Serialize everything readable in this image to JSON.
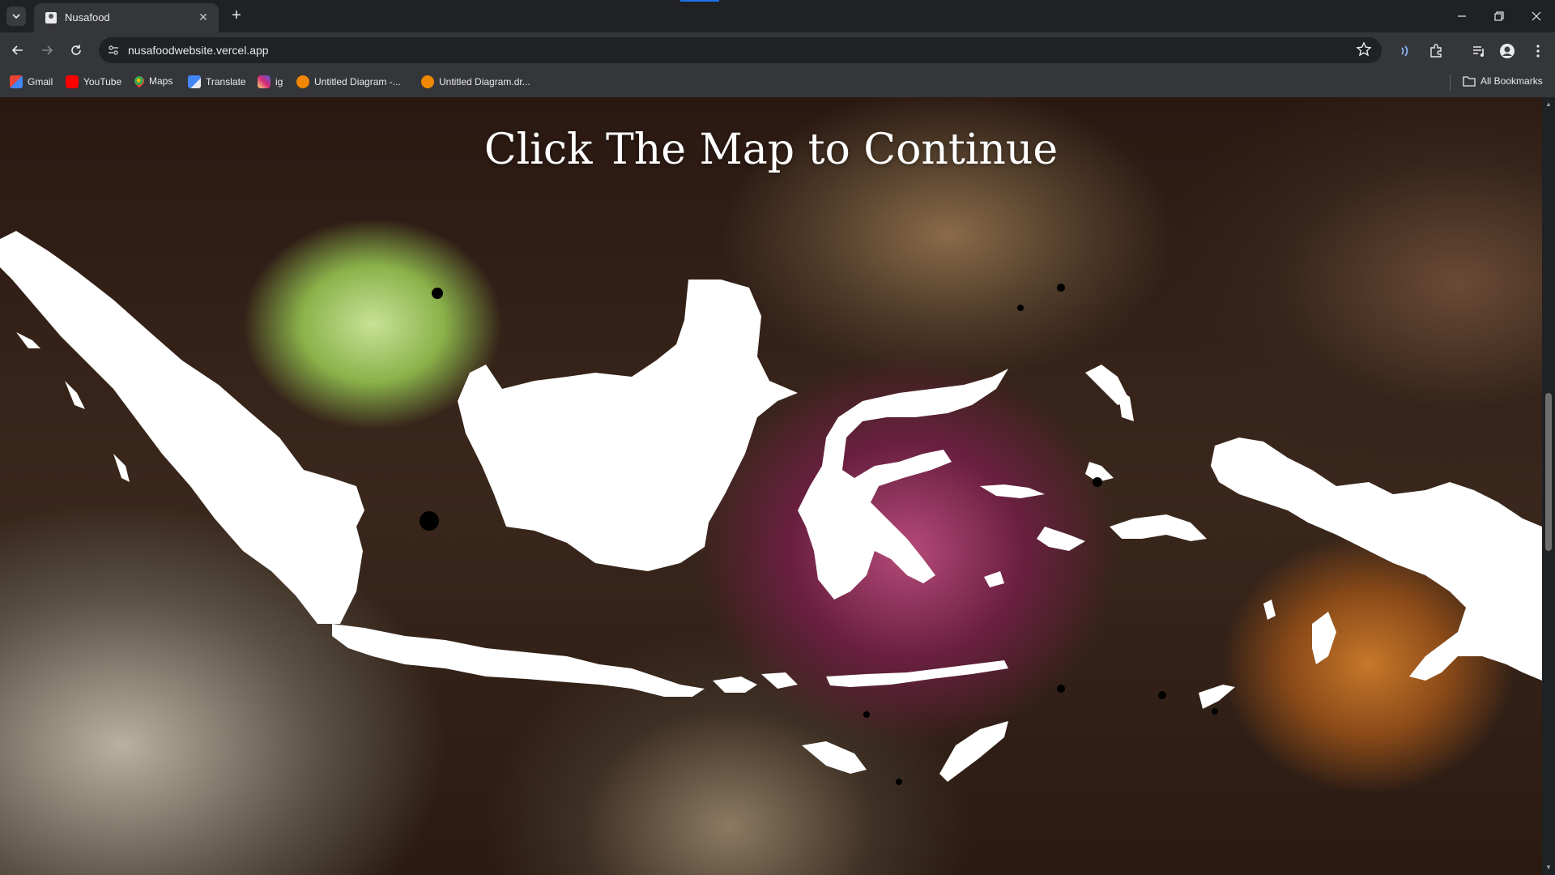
{
  "browser": {
    "tab": {
      "title": "Nusafood"
    },
    "address": {
      "url": "nusafoodwebsite.vercel.app"
    },
    "bookmarks": [
      {
        "label": "Gmail",
        "icon": "gmail-icon",
        "color": "#ea4335"
      },
      {
        "label": "YouTube",
        "icon": "youtube-icon",
        "color": "#ff0000"
      },
      {
        "label": "Maps",
        "icon": "maps-icon",
        "color": "#34a853"
      },
      {
        "label": "Translate",
        "icon": "translate-icon",
        "color": "#4285f4"
      },
      {
        "label": "ig",
        "icon": "instagram-icon",
        "color": "#d6249f"
      },
      {
        "label": "Untitled Diagram -...",
        "icon": "drawio-icon",
        "color": "#f08705"
      },
      {
        "label": "Untitled Diagram.dr...",
        "icon": "drawio-icon",
        "color": "#f08705"
      }
    ],
    "all_bookmarks_label": "All Bookmarks"
  },
  "page": {
    "heading": "Click The Map to Continue",
    "map_color": "#ffffff"
  }
}
